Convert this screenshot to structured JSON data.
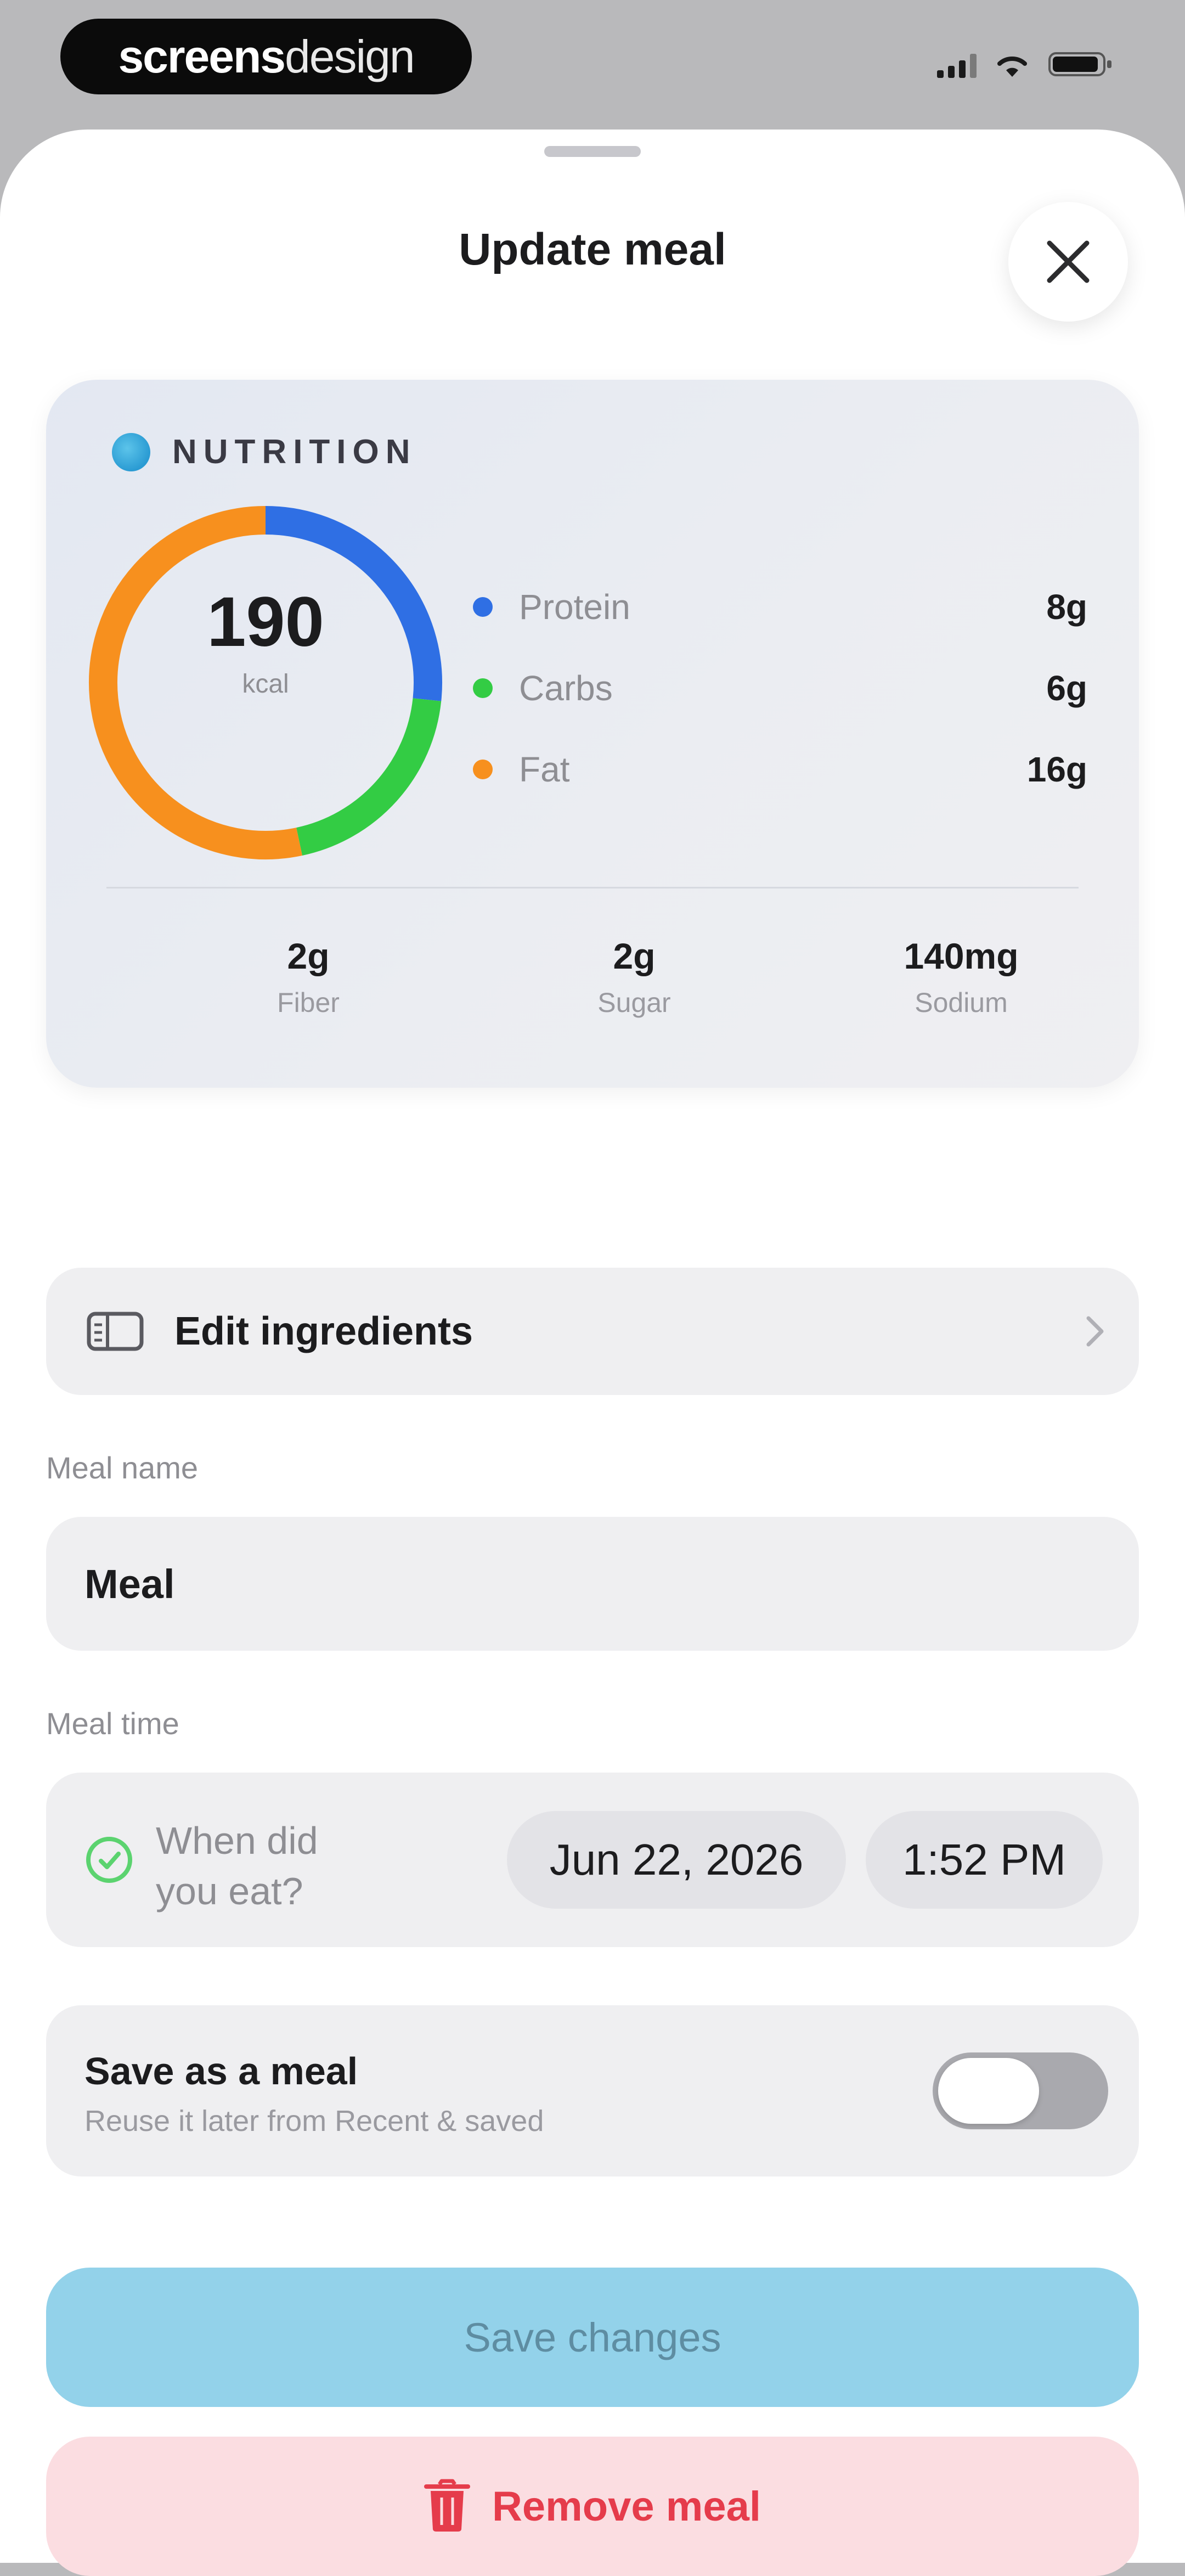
{
  "status_bar": {
    "brand_primary": "screens",
    "brand_secondary": "design",
    "icons": [
      "signal-icon",
      "wifi-icon",
      "battery-icon"
    ]
  },
  "sheet": {
    "title": "Update meal",
    "close_icon": "close-icon"
  },
  "nutrition": {
    "header": "NUTRITION",
    "kcal": "190",
    "kcal_unit": "kcal",
    "macros": [
      {
        "name": "Protein",
        "value": "8g",
        "color": "#2f6fe4",
        "amount_g": 8
      },
      {
        "name": "Carbs",
        "value": "6g",
        "color": "#33cc44",
        "amount_g": 6
      },
      {
        "name": "Fat",
        "value": "16g",
        "color": "#f7901e",
        "amount_g": 16
      }
    ],
    "micros": [
      {
        "value": "2g",
        "label": "Fiber"
      },
      {
        "value": "2g",
        "label": "Sugar"
      },
      {
        "value": "140mg",
        "label": "Sodium"
      }
    ]
  },
  "edit_ingredients": {
    "label": "Edit ingredients"
  },
  "meal_name": {
    "label": "Meal name",
    "value": "Meal"
  },
  "meal_time": {
    "label": "Meal time",
    "prompt_line1": "When did",
    "prompt_line2": "you eat?",
    "date": "Jun 22, 2026",
    "time": "1:52 PM"
  },
  "save_as_meal": {
    "title": "Save as a meal",
    "subtitle": "Reuse it later from Recent & saved",
    "enabled": false
  },
  "actions": {
    "save_label": "Save changes",
    "remove_label": "Remove meal"
  },
  "colors": {
    "accent": "#93d2ea",
    "danger": "#e53c4b",
    "danger_bg": "#fbdde1"
  }
}
